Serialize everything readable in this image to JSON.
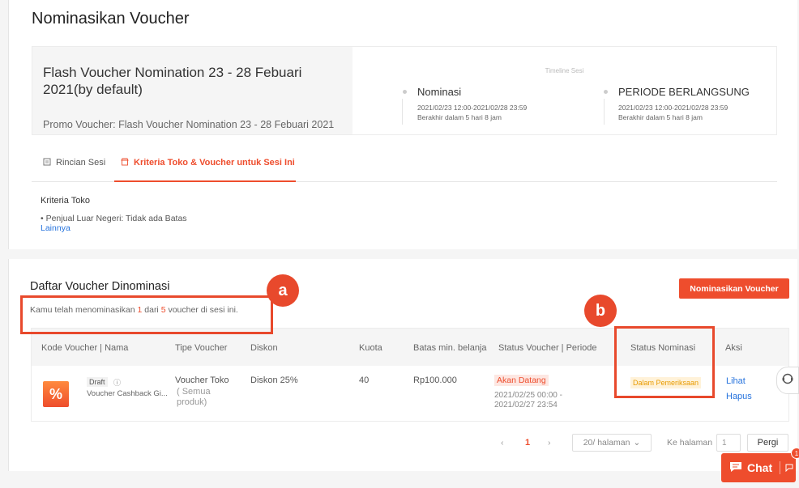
{
  "page": {
    "title": "Nominasikan Voucher"
  },
  "session": {
    "title": "Flash Voucher Nomination 23 - 28 Febuari 2021(by default)",
    "promo": "Promo Voucher: Flash Voucher Nomination 23 - 28 Febuari 2021",
    "timeline_title": "Timeline Sesi",
    "nominasi": {
      "name": "Nominasi",
      "date": "2021/02/23 12:00-2021/02/28 23:59",
      "remaining": "Berakhir dalam 5 hari 8 jam"
    },
    "periode": {
      "name": "PERIODE BERLANGSUNG",
      "date": "2021/02/23 12:00-2021/02/28 23:59",
      "remaining": "Berakhir dalam 5 hari 8 jam"
    }
  },
  "tabs": [
    {
      "label": "Rincian Sesi",
      "icon": "document-icon"
    },
    {
      "label": "Kriteria Toko & Voucher untuk Sesi Ini",
      "icon": "shop-icon",
      "active": true
    }
  ],
  "kriteria": {
    "title": "Kriteria Toko",
    "item": "• Penjual Luar Negeri: Tidak ada Batas",
    "more": "Lainnya"
  },
  "list": {
    "title": "Daftar Voucher Dinominasi",
    "sub_pre": "Kamu telah menominasikan ",
    "sub_count": "1",
    "sub_mid": " dari ",
    "sub_total": "5",
    "sub_post": " voucher di sesi ini.",
    "nominate_button": "Nominasikan Voucher"
  },
  "table": {
    "headers": [
      "Kode Voucher | Nama",
      "Tipe Voucher",
      "Diskon",
      "Kuota",
      "Batas min. belanja",
      "Status Voucher | Periode",
      "Status Nominasi",
      "Aksi"
    ],
    "row": {
      "icon_glyph": "%",
      "badge": "Draft",
      "info_glyph": "ⓘ",
      "name": "Voucher Cashback Gi...",
      "type_main": "Voucher Toko",
      "type_sub1": "( Semua",
      "type_sub2": "produk)",
      "discount": "Diskon 25%",
      "quota": "40",
      "min_spend": "Rp100.000",
      "status": "Akan Datang",
      "period": "2021/02/25 00:00 - 2021/02/27 23:54",
      "nomination_status": "Dalam Pemeriksaan",
      "action_view": "Lihat",
      "action_delete": "Hapus"
    }
  },
  "pagination": {
    "prev": "‹",
    "page": "1",
    "next": "›",
    "per_page": "20/ halaman",
    "goto_label": "Ke halaman",
    "goto_value": "1",
    "goto_button": "Pergi"
  },
  "annotations": {
    "a": "a",
    "b": "b"
  },
  "chat": {
    "label": "Chat",
    "badge": "1"
  },
  "colors": {
    "accent": "#ee4d2d",
    "link": "#2673dd",
    "annotation": "#e8492c"
  }
}
